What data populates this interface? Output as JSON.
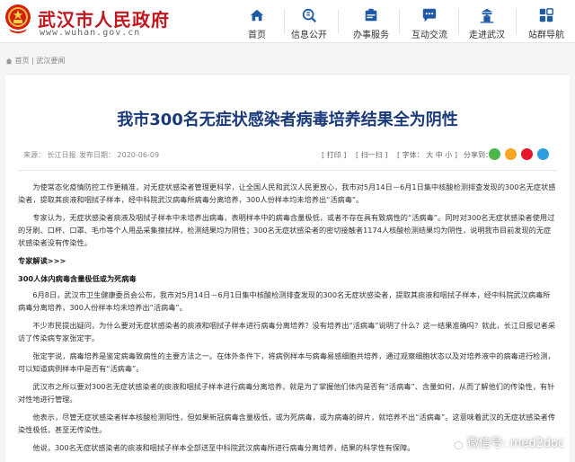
{
  "header": {
    "site_title": "武汉市人民政府",
    "site_url": "www.wuhan.gov.cn",
    "brand_color": "#c0171e",
    "nav": [
      {
        "label": "首页",
        "icon": "home-icon"
      },
      {
        "label": "信息公开",
        "icon": "info-publicity-icon"
      },
      {
        "label": "办事服务",
        "icon": "service-icon"
      },
      {
        "label": "互动交流",
        "icon": "chat-icon"
      },
      {
        "label": "走进武汉",
        "icon": "landmark-icon"
      },
      {
        "label": "站群导航",
        "icon": "grid-icon"
      }
    ]
  },
  "breadcrumb": {
    "home": "首页",
    "sep": "|",
    "section": "武汉要闻"
  },
  "article": {
    "title": "我市300名无症状感染者病毒培养结果全为阴性",
    "source": "来源： 长江日报",
    "time": "发布日期： 2020-06-09",
    "tools": {
      "print": "[ 打印 ]",
      "scan": "[ 扫一扫 ]",
      "font": "[ 字体： 大 中 小 ]",
      "share": "分享到："
    },
    "share_colors": [
      "#4cb64a",
      "#f5a623",
      "#e6162d",
      "#2d9ee0"
    ],
    "p1": "为使常态化疫情防控工作更精准，对无症状感染者管理更科学，让全国人民和武汉人民更放心，我市对5月14日－6月1日集中核酸检测排查发现的300名无症状感染者，提取其痰液和咽拭子样本，经中科院武汉病毒所病毒分离培养，300人份样本均未培养出“活病毒”。",
    "p2": "专家认为，无症状感染者痰液及咽拭子样本中未培养出病毒，表明样本中的病毒含量极低，或者不存在具有致病性的“活病毒”。同时对300名无症状感染者使用过的牙刷、口杯、口罩、毛巾等个人用品采集擦拭样，检测结果均为阴性；300名无症状感染者的密切接触者1174人核酸检测结果均为阴性，说明我市目前发现的无症状感染者没有传染性。",
    "sub1": "专家解读>>>",
    "sub2": "300人体内病毒含量极低或为死病毒",
    "p3": "6月8日，武汉市卫生健康委员会公布，我市对5月14日－6月1日集中核酸检测排查发现的300名无症状感染者，提取其痰液和咽拭子样本，经中科院武汉病毒所病毒分离培养，300人份样本均未培养出“活病毒”。",
    "p4": "不少市民提出疑问，为什么要对无症状感染者的痰液和咽拭子样本进行病毒分离培养？没有培养出“活病毒”说明了什么？这一结果准确吗？就此，长江日报记者采访了传染病专家张定宇。",
    "p5": "张定宇说，病毒培养是鉴定病毒致病性的主要方法之一。在体外条件下，将病例样本与病毒易感细胞共培养，通过观察细胞状态以及对培养液中的病毒进行检测，可以知道病例样本中是否有“活病毒”。",
    "p6": "武汉市之所以要对300名无症状感染者的痰液和咽拭子样本进行病毒分离培养，就是为了掌握他们体内是否有“活病毒”、含量如何，从而了解他们的传染性，有针对性地进行管理。",
    "p7": "他表示，尽管无症状感染者样本核酸检测阳性，但如果新冠病毒含量极低，或为死病毒，或为病毒的碎片，就培养不出“活病毒”。这意味着武汉的无症状感染者传染性极低，甚至无传染性。",
    "p8": "他说，300名无症状感染者的痰液和咽拭子样本全部送至中科院武汉病毒所进行病毒分离培养，结果的科学性有保障。"
  },
  "watermark": {
    "text": "微信号: med2doc"
  },
  "colors": {
    "title_blue": "#1a3a7a",
    "nav_blue": "#1f5aa6",
    "page_bg": "#f5f5f5"
  }
}
